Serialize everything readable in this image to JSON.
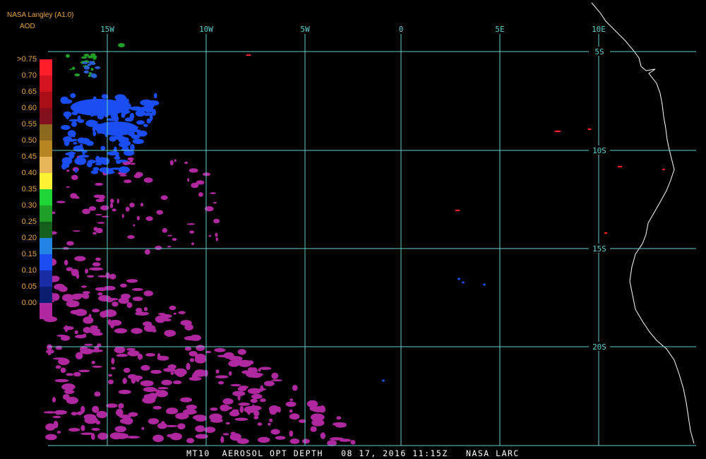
{
  "header": {
    "source": "NASA Langley (A1.0)",
    "product": "AOD"
  },
  "legend": {
    "labels": [
      ">0.75",
      "0.70",
      "0.65",
      "0.60",
      "0.55",
      "0.50",
      "0.45",
      "0.40",
      "0.35",
      "0.30",
      "0.25",
      "0.20",
      "0.15",
      "0.10",
      "0.05",
      "0.00"
    ],
    "colors": [
      "#ff1c2b",
      "#d41420",
      "#a80f17",
      "#84101d",
      "#8a6a1e",
      "#b78620",
      "#e6b55c",
      "#fcf133",
      "#1fd437",
      "#1f9f27",
      "#145f1c",
      "#2385e3",
      "#1b4ef2",
      "#1a2ca3",
      "#0b1d6e",
      "#b0289f"
    ]
  },
  "grid": {
    "lon_labels": [
      "15W",
      "10W",
      "5W",
      "0",
      "5E",
      "10E"
    ],
    "lat_labels": [
      "5S",
      "10S",
      "15S",
      "20S"
    ]
  },
  "footer": {
    "text": "MT10  AEROSOL OPT DEPTH   08 17, 2016 11:15Z   NASA LARC"
  },
  "colors": {
    "grid": "#5fd0d0",
    "coast": "#ffffff",
    "low_aod": "#b0289f",
    "mid_aod": "#1b4ef2",
    "high_aod": "#ff1c2b"
  }
}
